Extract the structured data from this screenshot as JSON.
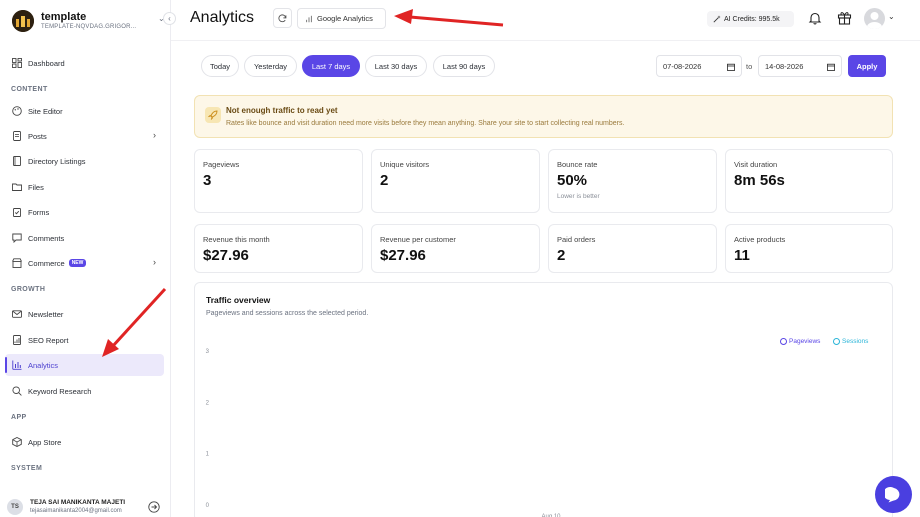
{
  "brand": {
    "name": "template",
    "subtitle": "TEMPLATE-NQVDAG.GRIGOR..."
  },
  "sidebar": {
    "sections": {
      "content": "CONTENT",
      "growth": "GROWTH",
      "app": "APP",
      "system": "SYSTEM"
    },
    "items": {
      "dashboard": "Dashboard",
      "site_editor": "Site Editor",
      "posts": "Posts",
      "directory": "Directory Listings",
      "files": "Files",
      "forms": "Forms",
      "comments": "Comments",
      "commerce": "Commerce",
      "commerce_badge": "NEW",
      "newsletter": "Newsletter",
      "seo": "SEO Report",
      "analytics": "Analytics",
      "keyword": "Keyword Research",
      "app_store": "App Store"
    },
    "user": {
      "initials": "TS",
      "name": "TEJA SAI MANIKANTA MAJETI",
      "email": "tejasaimanikanta2004@gmail.com"
    }
  },
  "header": {
    "title": "Analytics",
    "ga_button": "Google Analytics",
    "credits": "AI Credits: 995.5k"
  },
  "filters": {
    "ranges": [
      "Today",
      "Yesterday",
      "Last 7 days",
      "Last 30 days",
      "Last 90 days"
    ],
    "active_range": "Last 7 days",
    "from_date": "07-08-2026",
    "to_label": "to",
    "to_date": "14-08-2026",
    "apply": "Apply"
  },
  "alert": {
    "title": "Not enough traffic to read yet",
    "body": "Rates like bounce and visit duration need more visits before they mean anything. Share your site to start collecting real numbers."
  },
  "metrics": [
    {
      "label": "Pageviews",
      "value": "3",
      "note": ""
    },
    {
      "label": "Unique visitors",
      "value": "2",
      "note": ""
    },
    {
      "label": "Bounce rate",
      "value": "50%",
      "note": "Lower is better"
    },
    {
      "label": "Visit duration",
      "value": "8m 56s",
      "note": ""
    },
    {
      "label": "Revenue this month",
      "value": "$27.96",
      "note": ""
    },
    {
      "label": "Revenue per customer",
      "value": "$27.96",
      "note": ""
    },
    {
      "label": "Paid orders",
      "value": "2",
      "note": ""
    },
    {
      "label": "Active products",
      "value": "11",
      "note": ""
    }
  ],
  "chart": {
    "title": "Traffic overview",
    "subtitle": "Pageviews and sessions across the selected period."
  },
  "chart_data": {
    "type": "line",
    "title": "Traffic overview",
    "subtitle": "Pageviews and sessions across the selected period.",
    "x": [
      "Aug 10"
    ],
    "yticks": [
      0,
      1,
      2,
      3
    ],
    "ylim": [
      0,
      3
    ],
    "series": [
      {
        "name": "Pageviews",
        "color": "#5a46e6",
        "values": []
      },
      {
        "name": "Sessions",
        "color": "#2bb5d8",
        "values": []
      }
    ],
    "legend": "top-right",
    "grid": false
  },
  "colors": {
    "accent": "#5a46e6",
    "alert_bg": "#fdf7e8",
    "annotation_arrow": "#e02424"
  }
}
